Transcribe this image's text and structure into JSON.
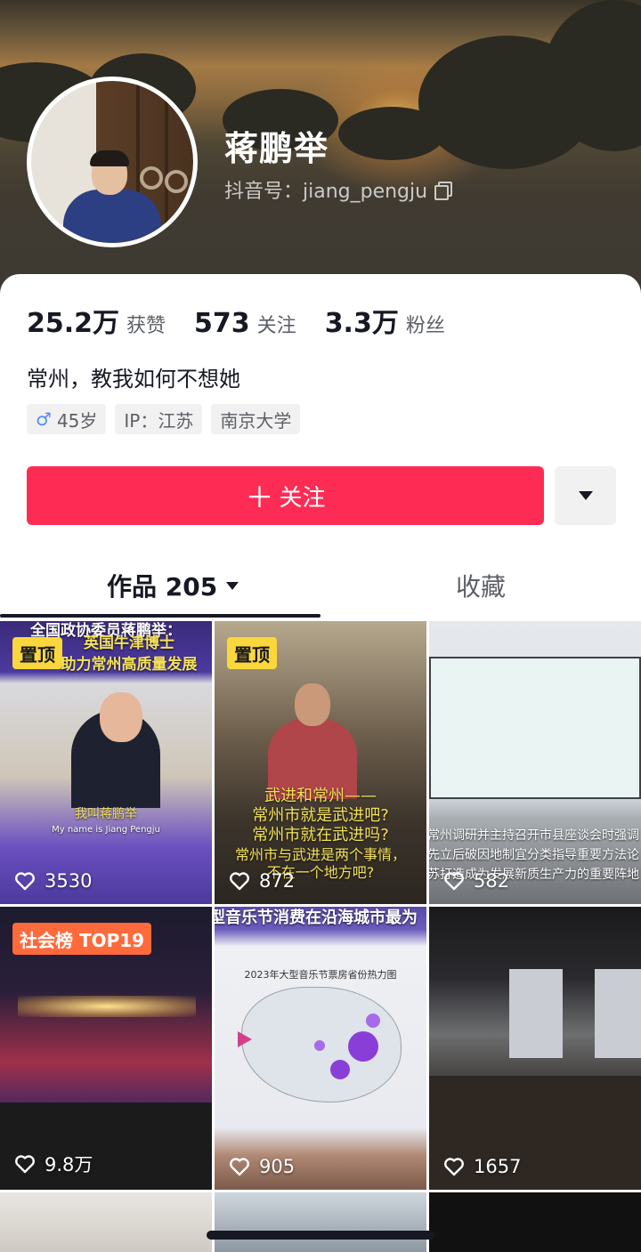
{
  "profile": {
    "nickname": "蒋鹏举",
    "douyin_id": "抖音号：jiang_pengju"
  },
  "stats": {
    "likes_num": "25.2万",
    "likes_label": "获赞",
    "following_num": "573",
    "following_label": "关注",
    "followers_num": "3.3万",
    "followers_label": "粉丝"
  },
  "bio": "常州，教我如何不想她",
  "tags": {
    "gender_symbol": "♂",
    "age": "45岁",
    "ip": "IP：江苏",
    "school": "南京大学"
  },
  "actions": {
    "follow_label": "关注",
    "follow_plus": "＋"
  },
  "tabs": {
    "works": "作品 205",
    "favorites": "收藏"
  },
  "videos": [
    {
      "badge": "置顶",
      "likes": "3530",
      "caption_1": "全国政协委员蒋鹏举：",
      "caption_2": "英国牛津博士",
      "caption_3": "助力常州高质量发展",
      "caption_4": "我叫蒋鹏举",
      "caption_5": "My name is Jiang Pengju"
    },
    {
      "badge": "置顶",
      "likes": "872",
      "caption_1": "武进和常州——",
      "caption_2": "常州市就是武进吧?",
      "caption_3": "常州市就在武进吗?",
      "caption_4": "常州市与武进是两个事情，",
      "caption_5": "不在一个地方吧?"
    },
    {
      "likes": "582",
      "caption_1": "常州调研并主持召开市县座谈会时强调",
      "caption_2": "先立后破因地制宜分类指导重要方法论",
      "caption_3": "苏打造成为发展新质生产力的重要阵地"
    },
    {
      "badge": "社会榜 TOP19",
      "likes": "9.8万"
    },
    {
      "likes": "905",
      "caption_1": "型音乐节消费在沿海城市最为",
      "caption_2": "2023年大型音乐节票房省份热力图"
    },
    {
      "likes": "1657"
    }
  ],
  "colors": {
    "accent": "#fe2c55",
    "pin_badge": "#fad73d",
    "rank_badge": "#fe6a3b"
  }
}
